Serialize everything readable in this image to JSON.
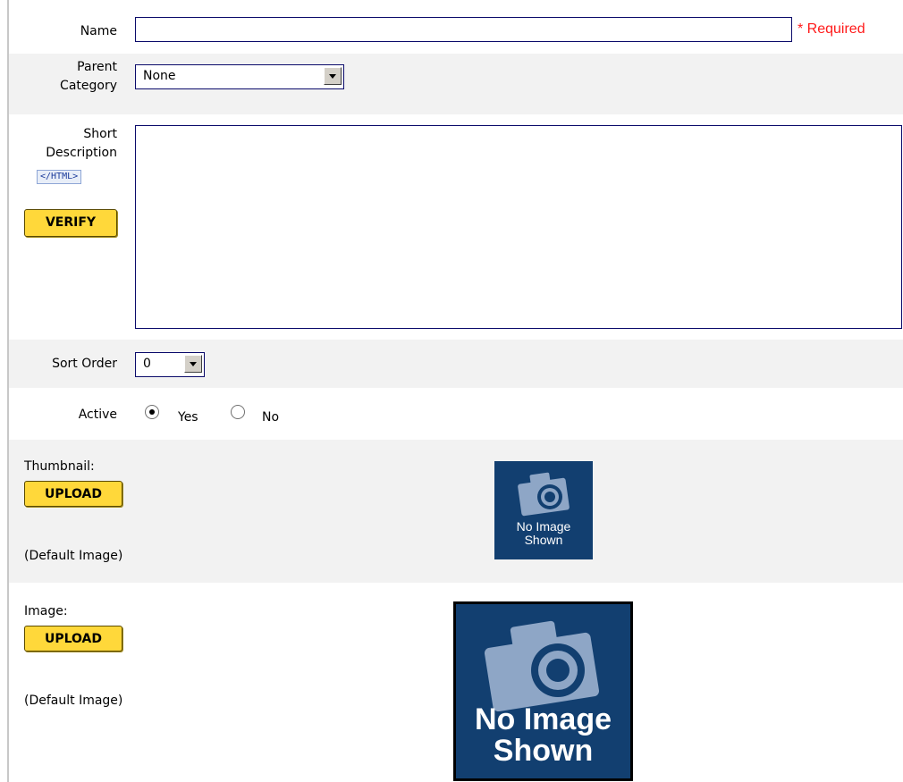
{
  "form": {
    "name": {
      "label": "Name",
      "value": "",
      "required_text": "* Required"
    },
    "parent_category": {
      "label_line1": "Parent",
      "label_line2": "Category",
      "selected": "None"
    },
    "short_description": {
      "label_line1": "Short",
      "label_line2": "Description",
      "html_badge": "</HTML>",
      "verify_label": "VERIFY",
      "value": ""
    },
    "sort_order": {
      "label": "Sort Order",
      "selected": "0"
    },
    "active": {
      "label": "Active",
      "options": [
        {
          "label": "Yes",
          "checked": true
        },
        {
          "label": "No",
          "checked": false
        }
      ]
    },
    "thumbnail": {
      "label": "Thumbnail:",
      "upload_label": "UPLOAD",
      "default_text": "(Default Image)",
      "placeholder_line1": "No Image",
      "placeholder_line2": "Shown"
    },
    "image": {
      "label": "Image:",
      "upload_label": "UPLOAD",
      "default_text": "(Default Image)",
      "placeholder_line1": "No Image",
      "placeholder_line2": "Shown"
    }
  },
  "colors": {
    "input_border": "#0a0a6a",
    "button_yellow": "#ffd83a",
    "required_red": "#ff1a1a",
    "placeholder_bg": "#123f70",
    "row_shade": "#f2f2f2"
  },
  "icons": {
    "dropdown": "chevron-down-icon",
    "camera": "camera-icon"
  }
}
